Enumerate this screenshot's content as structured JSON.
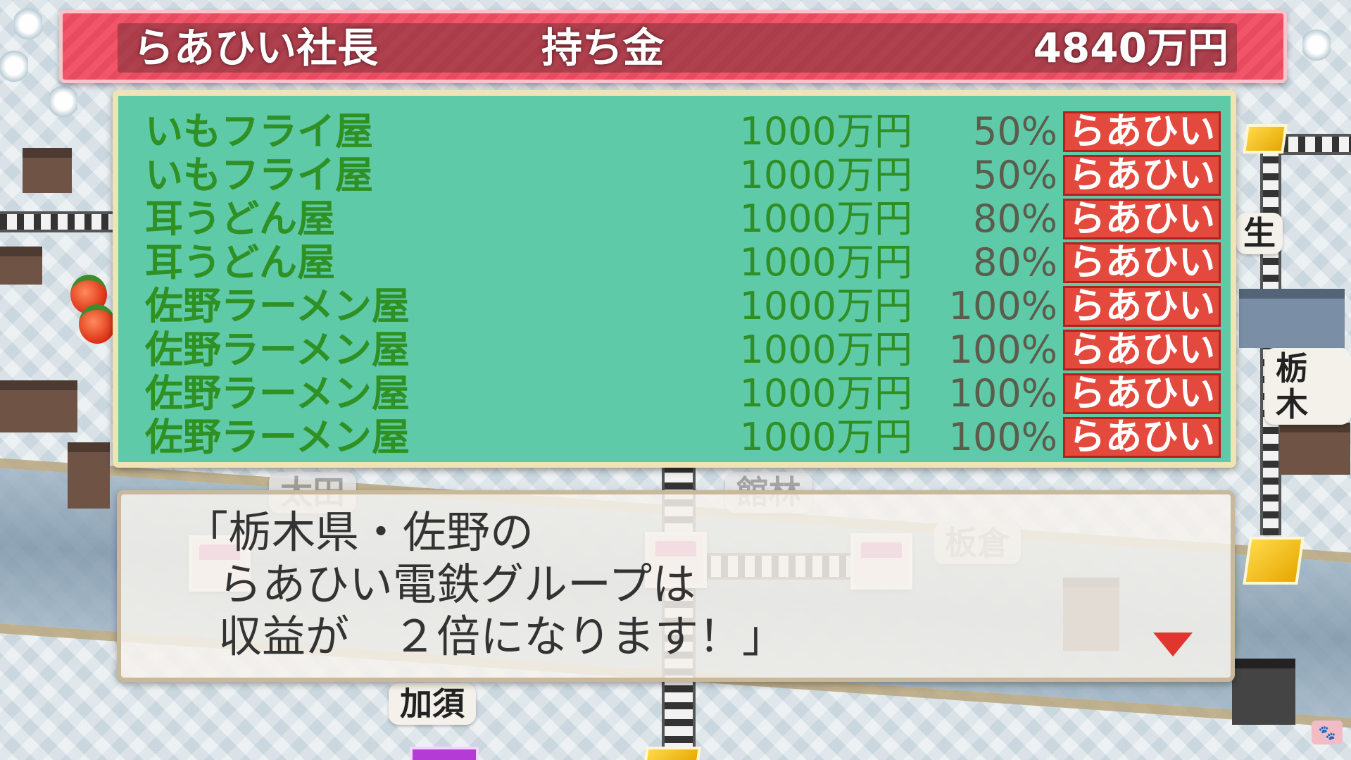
{
  "header": {
    "player": "らあひい社長",
    "money_label": "持ち金",
    "money_value": "4840万円"
  },
  "properties": [
    {
      "name": "いもフライ屋",
      "price": "1000万円",
      "rate": "50%",
      "owner": "らあひい"
    },
    {
      "name": "いもフライ屋",
      "price": "1000万円",
      "rate": "50%",
      "owner": "らあひい"
    },
    {
      "name": "耳うどん屋",
      "price": "1000万円",
      "rate": "80%",
      "owner": "らあひい"
    },
    {
      "name": "耳うどん屋",
      "price": "1000万円",
      "rate": "80%",
      "owner": "らあひい"
    },
    {
      "name": "佐野ラーメン屋",
      "price": "1000万円",
      "rate": "100%",
      "owner": "らあひい"
    },
    {
      "name": "佐野ラーメン屋",
      "price": "1000万円",
      "rate": "100%",
      "owner": "らあひい"
    },
    {
      "name": "佐野ラーメン屋",
      "price": "1000万円",
      "rate": "100%",
      "owner": "らあひい"
    },
    {
      "name": "佐野ラーメン屋",
      "price": "1000万円",
      "rate": "100%",
      "owner": "らあひい"
    }
  ],
  "dialog": {
    "line1": "「栃木県・佐野の",
    "line2": "らあひい電鉄グループは",
    "line3": "収益が　２倍になります！」"
  },
  "map_labels": {
    "tochigi": "栃木",
    "kazo": "加須",
    "tatebayashi": "館林",
    "itakura": "板倉",
    "ota": "太田",
    "partial_right": "生"
  },
  "colors": {
    "header_red": "#e84a5f",
    "panel_green": "#5ecaa8",
    "owner_red": "#e3493d",
    "name_green": "#2f9024"
  }
}
